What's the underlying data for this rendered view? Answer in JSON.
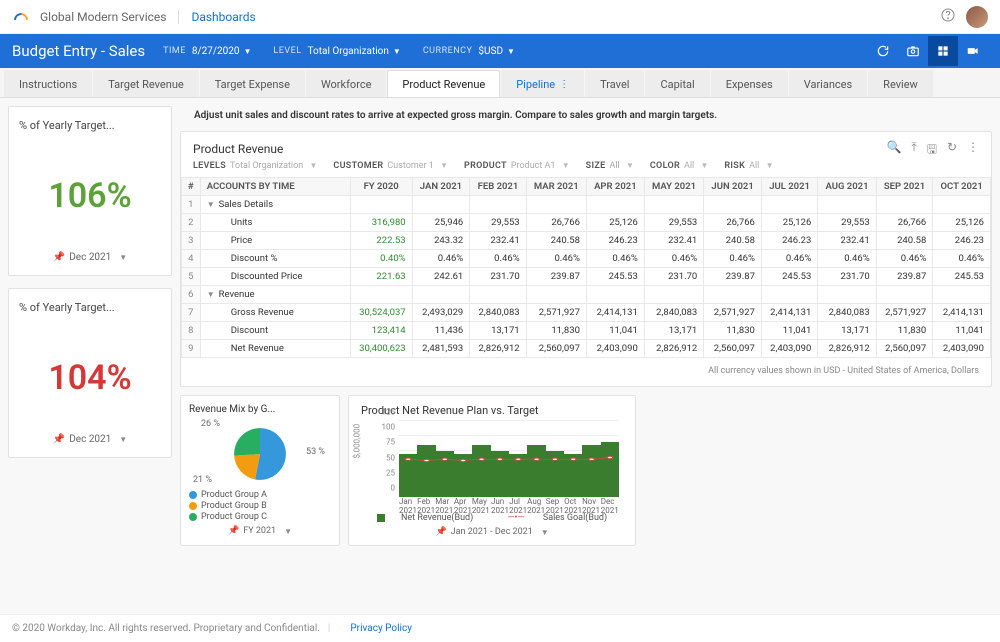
{
  "header": {
    "org": "Global Modern Services",
    "crumb": "Dashboards"
  },
  "bluebar": {
    "title": "Budget Entry - Sales",
    "params": {
      "time_label": "TIME",
      "time_value": "8/27/2020",
      "level_label": "LEVEL",
      "level_value": "Total Organization",
      "currency_label": "CURRENCY",
      "currency_value": "$USD"
    }
  },
  "tabs": [
    "Instructions",
    "Target Revenue",
    "Target Expense",
    "Workforce",
    "Product Revenue",
    "Pipeline",
    "Travel",
    "Capital",
    "Expenses",
    "Variances",
    "Review"
  ],
  "active_tab": "Product Revenue",
  "next_tab": "Pipeline",
  "instruction": "Adjust unit sales and discount rates to arrive at expected gross margin.  Compare to sales growth and margin targets.",
  "kpis": [
    {
      "title": "% of Yearly Target...",
      "value": "106%",
      "color": "green",
      "period": "Dec 2021"
    },
    {
      "title": "% of Yearly Target...",
      "value": "104%",
      "color": "red",
      "period": "Dec 2021"
    }
  ],
  "revenue_panel": {
    "title": "Product Revenue",
    "filters": {
      "levels_label": "LEVELS",
      "levels_value": "Total Organization",
      "customer_label": "CUSTOMER",
      "customer_value": "Customer 1",
      "product_label": "PRODUCT",
      "product_value": "Product A1",
      "size_label": "SIZE",
      "size_value": "All",
      "color_label": "COLOR",
      "color_value": "All",
      "risk_label": "RISK",
      "risk_value": "All"
    },
    "columns": [
      "#",
      "ACCOUNTS BY TIME",
      "FY 2020",
      "JAN 2021",
      "FEB 2021",
      "MAR 2021",
      "APR 2021",
      "MAY 2021",
      "JUN 2021",
      "JUL 2021",
      "AUG 2021",
      "SEP 2021",
      "OCT 2021"
    ],
    "rows": [
      {
        "n": "1",
        "label": "Sales Details",
        "indent": 0,
        "exp": true,
        "vals": [
          "",
          "",
          "",
          "",
          "",
          "",
          "",
          "",
          "",
          "",
          ""
        ]
      },
      {
        "n": "2",
        "label": "Units",
        "indent": 2,
        "vals": [
          "316,980",
          "25,946",
          "29,553",
          "26,766",
          "25,126",
          "29,553",
          "26,766",
          "25,126",
          "29,553",
          "26,766",
          "25,126"
        ]
      },
      {
        "n": "3",
        "label": "Price",
        "indent": 2,
        "vals": [
          "222.53",
          "243.32",
          "232.41",
          "240.58",
          "246.23",
          "232.41",
          "240.58",
          "246.23",
          "232.41",
          "240.58",
          "246.23"
        ]
      },
      {
        "n": "4",
        "label": "Discount %",
        "indent": 2,
        "vals": [
          "0.40%",
          "0.46%",
          "0.46%",
          "0.46%",
          "0.46%",
          "0.46%",
          "0.46%",
          "0.46%",
          "0.46%",
          "0.46%",
          "0.46%"
        ]
      },
      {
        "n": "5",
        "label": "Discounted Price",
        "indent": 2,
        "vals": [
          "221.63",
          "242.61",
          "231.70",
          "239.87",
          "245.53",
          "231.70",
          "239.87",
          "245.53",
          "231.70",
          "239.87",
          "245.53"
        ]
      },
      {
        "n": "6",
        "label": "Revenue",
        "indent": 0,
        "exp": true,
        "vals": [
          "",
          "",
          "",
          "",
          "",
          "",
          "",
          "",
          "",
          "",
          ""
        ]
      },
      {
        "n": "7",
        "label": "Gross Revenue",
        "indent": 2,
        "vals": [
          "30,524,037",
          "2,493,029",
          "2,840,083",
          "2,571,927",
          "2,414,131",
          "2,840,083",
          "2,571,927",
          "2,414,131",
          "2,840,083",
          "2,571,927",
          "2,414,131"
        ]
      },
      {
        "n": "8",
        "label": "Discount",
        "indent": 2,
        "vals": [
          "123,414",
          "11,436",
          "13,171",
          "11,830",
          "11,041",
          "13,171",
          "11,830",
          "11,041",
          "13,171",
          "11,830",
          "11,041"
        ]
      },
      {
        "n": "9",
        "label": "Net Revenue",
        "indent": 2,
        "vals": [
          "30,400,623",
          "2,481,593",
          "2,826,912",
          "2,560,097",
          "2,403,090",
          "2,826,912",
          "2,560,097",
          "2,403,090",
          "2,826,912",
          "2,560,097",
          "2,403,090"
        ]
      }
    ],
    "note": "All currency values shown in USD - United States of America, Dollars"
  },
  "pie_panel": {
    "title": "Revenue Mix by G...",
    "legend": [
      "Product Group A",
      "Product Group B",
      "Product Group C"
    ],
    "colors": [
      "#3498db",
      "#f39c12",
      "#27ae60"
    ],
    "period": "FY 2021"
  },
  "bar_panel": {
    "title": "Product Net Revenue Plan vs. Target",
    "ylabel": "$,000,000",
    "legend": {
      "bars": "Net Revenue(Bud)",
      "line": "Sales Goal(Bud)"
    },
    "period": "Jan 2021 - Dec 2021"
  },
  "chart_data": [
    {
      "type": "pie",
      "title": "Revenue Mix by Group",
      "series": [
        {
          "name": "Product Group A",
          "value": 53
        },
        {
          "name": "Product Group B",
          "value": 21
        },
        {
          "name": "Product Group C",
          "value": 26
        }
      ]
    },
    {
      "type": "bar+line",
      "title": "Product Net Revenue Plan vs. Target",
      "ylabel": "$,000,000",
      "ylim": [
        0,
        125
      ],
      "yticks": [
        0,
        25,
        50,
        75,
        100,
        125
      ],
      "categories": [
        "Jan 2021",
        "Feb 2021",
        "Mar 2021",
        "Apr 2021",
        "May 2021",
        "Jun 2021",
        "Jul 2021",
        "Aug 2021",
        "Sep 2021",
        "Oct 2021",
        "Nov 2021",
        "Dec 2021"
      ],
      "series": [
        {
          "name": "Net Revenue(Bud)",
          "kind": "bar",
          "values": [
            70,
            85,
            75,
            70,
            85,
            75,
            70,
            85,
            75,
            70,
            85,
            90
          ]
        },
        {
          "name": "Sales Goal(Bud)",
          "kind": "line",
          "values": [
            62,
            60,
            62,
            60,
            62,
            62,
            62,
            62,
            62,
            62,
            62,
            65
          ]
        }
      ]
    }
  ],
  "footer": {
    "copyright": "© 2020 Workday, Inc. All rights reserved. Proprietary and Confidential.",
    "link": "Privacy Policy"
  }
}
